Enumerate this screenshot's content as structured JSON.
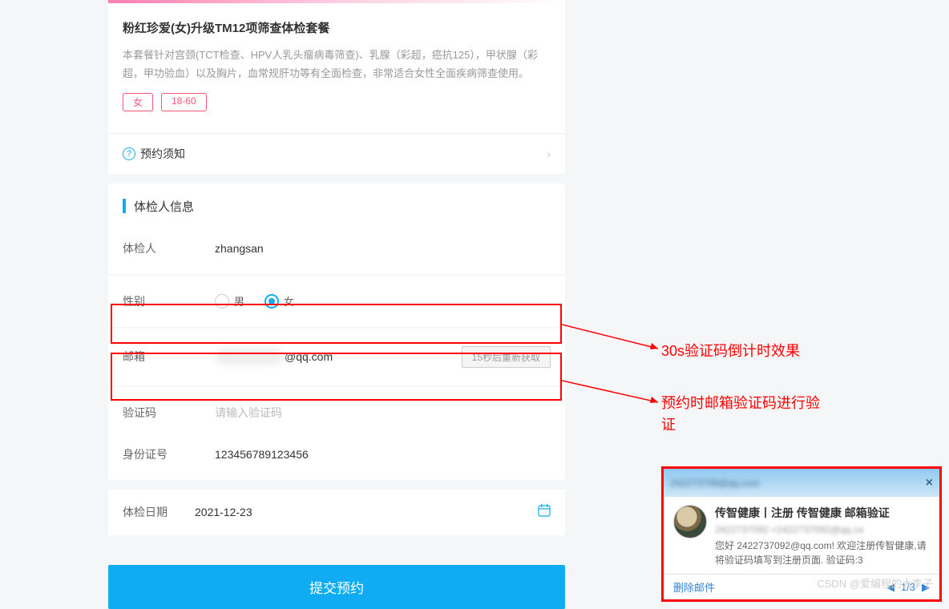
{
  "package": {
    "title": "粉红珍爱(女)升级TM12项筛查体检套餐",
    "description": "本套餐针对宫颈(TCT检查、HPV人乳头瘤病毒筛查)、乳腺（彩超，癌抗125），甲状腺（彩超，甲功验血）以及胸片，血常规肝功等有全面检查，非常适合女性全面疾病筛查使用。",
    "tag_gender": "女",
    "tag_age": "18-60"
  },
  "notice_label": "预约须知",
  "section_title": "体检人信息",
  "form": {
    "name_label": "体检人",
    "name_value": "zhangsan",
    "gender_label": "性别",
    "gender_male": "男",
    "gender_female": "女",
    "email_label": "邮箱",
    "email_suffix": "@qq.com",
    "countdown_button": "15秒后重新获取",
    "code_label": "验证码",
    "code_placeholder": "请输入验证码",
    "id_label": "身份证号",
    "id_value": "123456789123456",
    "date_label": "体检日期",
    "date_value": "2021-12-23"
  },
  "submit_label": "提交预约",
  "annotations": {
    "line1": "30s验证码倒计时效果",
    "line2": "预约时邮箱验证码进行验证"
  },
  "popup": {
    "header_email": "242273709@qq.com",
    "title": "传智健康丨注册 传智健康 邮箱验证",
    "sub": "2422737092 <2422737092@qq.co",
    "body": "您好 2422737092@qq.com! 欢迎注册传智健康,请将验证码填写到注册页面. 验证码:3",
    "delete": "删除邮件",
    "page": "1/3"
  },
  "watermark": "CSDN @爱编程的大李子"
}
